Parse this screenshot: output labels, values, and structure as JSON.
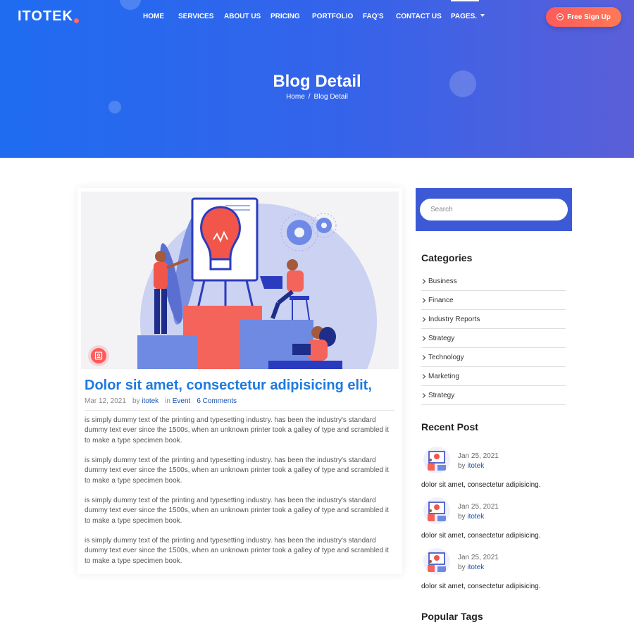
{
  "header": {
    "logo": "ITOTEK",
    "nav": [
      "HOME",
      "SERVICES",
      "ABOUT US",
      "PRICING",
      "PORTFOLIO",
      "FAQ'S",
      "CONTACT US",
      "PAGES."
    ],
    "signup_label": "Free Sign Up"
  },
  "hero": {
    "title": "Blog Detail",
    "breadcrumb": {
      "home": "Home",
      "separator": "/",
      "current": "Blog Detail"
    }
  },
  "post": {
    "title": "Dolor sit amet, consectetur adipisicing elit,",
    "date": "Mar 12, 2021",
    "by_label": "by",
    "author": "itotek",
    "in_label": "in",
    "category": "Event",
    "comments": "6 Comments",
    "paragraphs": [
      "is simply dummy text of the printing and typesetting industry. has been the industry's standard dummy text ever since the 1500s, when an unknown printer took a galley of type and scrambled it to make a type specimen book.",
      "is simply dummy text of the printing and typesetting industry. has been the industry's standard dummy text ever since the 1500s, when an unknown printer took a galley of type and scrambled it to make a type specimen book.",
      "is simply dummy text of the printing and typesetting industry. has been the industry's standard dummy text ever since the 1500s, when an unknown printer took a galley of type and scrambled it to make a type specimen book.",
      "is simply dummy text of the printing and typesetting industry. has been the industry's standard dummy text ever since the 1500s, when an unknown printer took a galley of type and scrambled it to make a type specimen book."
    ]
  },
  "sidebar": {
    "search_placeholder": "Search",
    "categories_title": "Categories",
    "categories": [
      "Business",
      "Finance",
      "Industry Reports",
      "Strategy",
      "Technology",
      "Marketing",
      "Strategy"
    ],
    "recent_title": "Recent Post",
    "recent": [
      {
        "date": "Jan 25, 2021",
        "by": "by",
        "author": "itotek",
        "title": "dolor sit amet, consectetur adipisicing."
      },
      {
        "date": "Jan 25, 2021",
        "by": "by",
        "author": "itotek",
        "title": "dolor sit amet, consectetur adipisicing."
      },
      {
        "date": "Jan 25, 2021",
        "by": "by",
        "author": "itotek",
        "title": "dolor sit amet, consectetur adipisicing."
      }
    ],
    "tags_title": "Popular Tags"
  },
  "colors": {
    "hero_start": "#1f6cf1",
    "hero_end": "#5a5fd8",
    "accent": "#ff5a5a",
    "title_blue": "#1f7ae0",
    "search_panel": "#3d5ad6"
  }
}
